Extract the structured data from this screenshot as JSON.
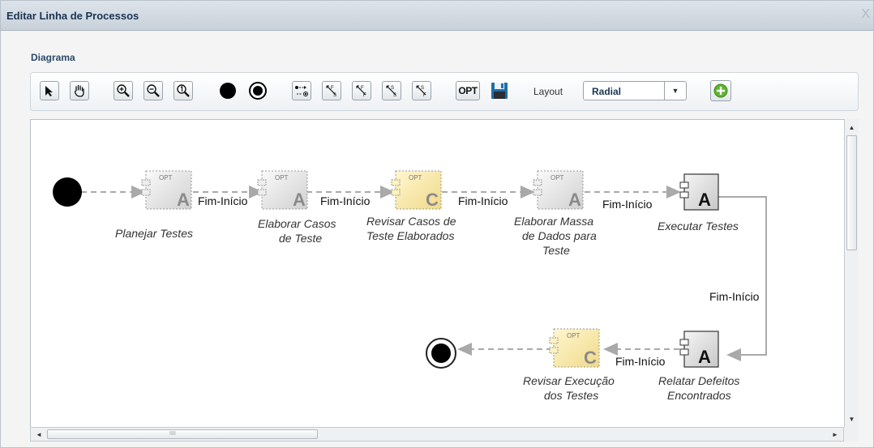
{
  "window": {
    "title": "Editar Linha de Processos",
    "close_glyph": "X"
  },
  "panel": {
    "title": "Diagrama"
  },
  "toolbar": {
    "buttons": [
      {
        "name": "select-arrow-icon"
      },
      {
        "name": "pan-hand-icon"
      },
      {
        "name": "zoom-in-icon"
      },
      {
        "name": "zoom-out-icon"
      },
      {
        "name": "zoom-reset-icon"
      },
      {
        "name": "start-node-icon"
      },
      {
        "name": "end-node-icon"
      },
      {
        "name": "connector-icon"
      },
      {
        "name": "finish-start-link-icon"
      },
      {
        "name": "finish-finish-link-icon"
      },
      {
        "name": "start-start-link-icon"
      },
      {
        "name": "start-finish-link-icon"
      },
      {
        "name": "opt-icon"
      },
      {
        "name": "save-icon"
      }
    ],
    "opt_label": "OPT",
    "layout_label": "Layout",
    "layout_value": "Radial",
    "add_icon": "add-green-icon",
    "icon_labels": {
      "ff": "F",
      "s": "S"
    }
  },
  "diagram": {
    "activities": [
      {
        "id": "a1",
        "label_lines": [
          "Planejar Testes"
        ],
        "letter": "A",
        "opt": "OPT",
        "style": "optional-gray"
      },
      {
        "id": "a2",
        "label_lines": [
          "Elaborar Casos",
          "de Teste"
        ],
        "letter": "A",
        "opt": "OPT",
        "style": "optional-gray"
      },
      {
        "id": "a3",
        "label_lines": [
          "Revisar Casos de",
          "Teste Elaborados"
        ],
        "letter": "C",
        "opt": "OPT",
        "style": "optional-yellow"
      },
      {
        "id": "a4",
        "label_lines": [
          "Elaborar Massa",
          "de Dados para",
          "Teste"
        ],
        "letter": "A",
        "opt": "OPT",
        "style": "optional-gray"
      },
      {
        "id": "a5",
        "label_lines": [
          "Executar Testes"
        ],
        "letter": "A",
        "opt": "",
        "style": "mandatory"
      },
      {
        "id": "a6",
        "label_lines": [
          "Relatar Defeitos",
          "Encontrados"
        ],
        "letter": "A",
        "opt": "",
        "style": "mandatory"
      },
      {
        "id": "a7",
        "label_lines": [
          "Revisar Execução",
          "dos Testes"
        ],
        "letter": "C",
        "opt": "OPT",
        "style": "optional-yellow"
      }
    ],
    "links": [
      {
        "label": "Fim-Início"
      },
      {
        "label": "Fim-Início"
      },
      {
        "label": "Fim-Início"
      },
      {
        "label": "Fim-Início"
      },
      {
        "label": "Fim-Início"
      },
      {
        "label": "Fim-Início"
      }
    ]
  },
  "scrollbar": {
    "up": "▲",
    "down": "▼",
    "left": "◄",
    "right": "►",
    "thumb_grip": "IIII"
  },
  "colors": {
    "title_text": "#1a3553",
    "optional_fill": "#e4e4e4",
    "optional_yellow_fill": "#f6e6a2",
    "link_dashed": "#a9a9a9",
    "link_solid": "#a9a9a9"
  }
}
